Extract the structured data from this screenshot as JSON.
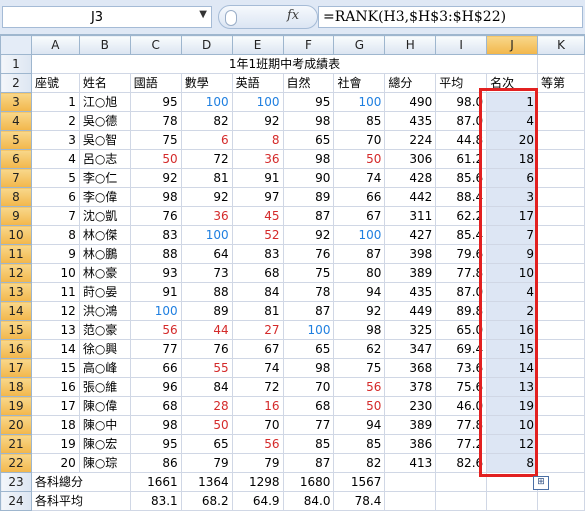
{
  "formula_bar": {
    "name_box": "J3",
    "fx_label": "fx",
    "formula": "=RANK(H3,$H$3:$H$22)"
  },
  "columns": [
    "A",
    "B",
    "C",
    "D",
    "E",
    "F",
    "G",
    "H",
    "I",
    "J",
    "K"
  ],
  "selected_column": "J",
  "row_numbers": [
    1,
    2,
    3,
    4,
    5,
    6,
    7,
    8,
    9,
    10,
    11,
    12,
    13,
    14,
    15,
    16,
    17,
    18,
    19,
    20,
    21,
    22,
    23,
    24
  ],
  "selected_rows": [
    3,
    4,
    5,
    6,
    7,
    8,
    9,
    10,
    11,
    12,
    13,
    14,
    15,
    16,
    17,
    18,
    19,
    20,
    21,
    22
  ],
  "title": "1年1班期中考成績表",
  "headers": [
    "座號",
    "姓名",
    "國語",
    "數學",
    "英語",
    "自然",
    "社會",
    "總分",
    "平均",
    "名次",
    "等第"
  ],
  "students": [
    {
      "no": "1",
      "name": "江○旭",
      "chinese": "95",
      "math": "100",
      "english": "100",
      "science": "95",
      "social": "100",
      "total": "490",
      "avg": "98.0",
      "rank": "1"
    },
    {
      "no": "2",
      "name": "吳○德",
      "chinese": "78",
      "math": "82",
      "english": "92",
      "science": "98",
      "social": "85",
      "total": "435",
      "avg": "87.0",
      "rank": "4"
    },
    {
      "no": "3",
      "name": "吳○智",
      "chinese": "75",
      "math": "6",
      "english": "8",
      "science": "65",
      "social": "70",
      "total": "224",
      "avg": "44.8",
      "rank": "20"
    },
    {
      "no": "4",
      "name": "呂○志",
      "chinese": "50",
      "math": "72",
      "english": "36",
      "science": "98",
      "social": "50",
      "total": "306",
      "avg": "61.2",
      "rank": "18"
    },
    {
      "no": "5",
      "name": "李○仁",
      "chinese": "92",
      "math": "81",
      "english": "91",
      "science": "90",
      "social": "74",
      "total": "428",
      "avg": "85.6",
      "rank": "6"
    },
    {
      "no": "6",
      "name": "李○偉",
      "chinese": "98",
      "math": "92",
      "english": "97",
      "science": "89",
      "social": "66",
      "total": "442",
      "avg": "88.4",
      "rank": "3"
    },
    {
      "no": "7",
      "name": "沈○凱",
      "chinese": "76",
      "math": "36",
      "english": "45",
      "science": "87",
      "social": "67",
      "total": "311",
      "avg": "62.2",
      "rank": "17"
    },
    {
      "no": "8",
      "name": "林○傑",
      "chinese": "83",
      "math": "100",
      "english": "52",
      "science": "92",
      "social": "100",
      "total": "427",
      "avg": "85.4",
      "rank": "7"
    },
    {
      "no": "9",
      "name": "林○鵬",
      "chinese": "88",
      "math": "64",
      "english": "83",
      "science": "76",
      "social": "87",
      "total": "398",
      "avg": "79.6",
      "rank": "9"
    },
    {
      "no": "10",
      "name": "林○豪",
      "chinese": "93",
      "math": "73",
      "english": "68",
      "science": "75",
      "social": "80",
      "total": "389",
      "avg": "77.8",
      "rank": "10"
    },
    {
      "no": "11",
      "name": "莳○晏",
      "chinese": "91",
      "math": "88",
      "english": "84",
      "science": "78",
      "social": "94",
      "total": "435",
      "avg": "87.0",
      "rank": "4"
    },
    {
      "no": "12",
      "name": "洪○鴻",
      "chinese": "100",
      "math": "89",
      "english": "81",
      "science": "87",
      "social": "92",
      "total": "449",
      "avg": "89.8",
      "rank": "2"
    },
    {
      "no": "13",
      "name": "范○豪",
      "chinese": "56",
      "math": "44",
      "english": "27",
      "science": "100",
      "social": "98",
      "total": "325",
      "avg": "65.0",
      "rank": "16"
    },
    {
      "no": "14",
      "name": "徐○興",
      "chinese": "77",
      "math": "76",
      "english": "67",
      "science": "65",
      "social": "62",
      "total": "347",
      "avg": "69.4",
      "rank": "15"
    },
    {
      "no": "15",
      "name": "高○峰",
      "chinese": "66",
      "math": "55",
      "english": "74",
      "science": "98",
      "social": "75",
      "total": "368",
      "avg": "73.6",
      "rank": "14"
    },
    {
      "no": "16",
      "name": "張○維",
      "chinese": "96",
      "math": "84",
      "english": "72",
      "science": "70",
      "social": "56",
      "total": "378",
      "avg": "75.6",
      "rank": "13"
    },
    {
      "no": "17",
      "name": "陳○偉",
      "chinese": "68",
      "math": "28",
      "english": "16",
      "science": "68",
      "social": "50",
      "total": "230",
      "avg": "46.0",
      "rank": "19"
    },
    {
      "no": "18",
      "name": "陳○中",
      "chinese": "98",
      "math": "50",
      "english": "70",
      "science": "77",
      "social": "94",
      "total": "389",
      "avg": "77.8",
      "rank": "10"
    },
    {
      "no": "19",
      "name": "陳○宏",
      "chinese": "95",
      "math": "65",
      "english": "56",
      "science": "85",
      "social": "85",
      "total": "386",
      "avg": "77.2",
      "rank": "12"
    },
    {
      "no": "20",
      "name": "陳○琮",
      "chinese": "86",
      "math": "79",
      "english": "79",
      "science": "87",
      "social": "82",
      "total": "413",
      "avg": "82.6",
      "rank": "8"
    }
  ],
  "summary": {
    "totals_label": "各科總分",
    "totals": [
      "1661",
      "1364",
      "1298",
      "1680",
      "1567"
    ],
    "avg_label": "各科平均",
    "avgs": [
      "83.1",
      "68.2",
      "64.9",
      "84.0",
      "78.4"
    ]
  },
  "colors": {
    "perfect_score": "#1f7fe0",
    "failing_score": "#d42a2a",
    "selection_outline": "#e22020"
  }
}
